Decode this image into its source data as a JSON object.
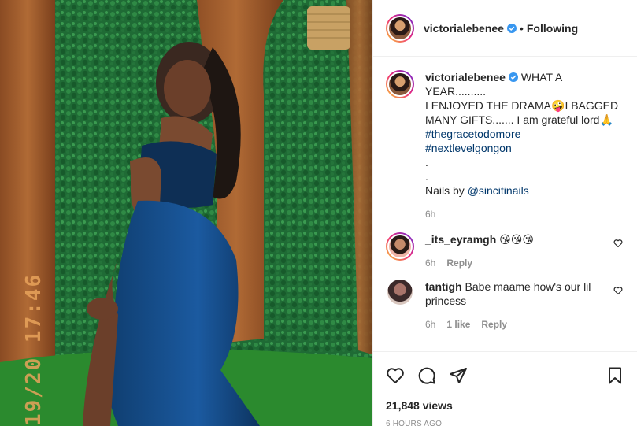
{
  "post": {
    "username": "victorialebenee",
    "follow_separator": "•",
    "follow_state": "Following",
    "more_label": "•••",
    "caption": {
      "username": "victorialebenee",
      "line1": "WHAT A YEAR..........",
      "line2a": "I ENJOYED THE DRAMA",
      "emoji1": "🤪",
      "line2b": "I BAGGED",
      "line3": "MANY GIFTS....... I am grateful lord",
      "emoji2": "🙏",
      "hashtag1": "#thegracetodomore",
      "hashtag2": "#nextlevelgongon",
      "dot1": ".",
      "dot2": ".",
      "nails_prefix": "Nails by ",
      "mention": "@sincitinails",
      "time": "6h"
    },
    "views": "21,848 views",
    "time_ago": "6 HOURS AGO"
  },
  "media": {
    "timestamp": "19/20 17:46"
  },
  "comments": [
    {
      "username": "_its_eyramgh",
      "text": "😘😘😘",
      "time": "6h",
      "likes": "",
      "reply": "Reply"
    },
    {
      "username": "tantigh",
      "text": "Babe maame how's our lil princess",
      "time": "6h",
      "likes": "1 like",
      "reply": "Reply"
    }
  ],
  "icons": {
    "like": "heart-outline-icon",
    "comment": "comment-bubble-icon",
    "share": "paper-plane-icon",
    "save": "bookmark-icon",
    "verified": "verified-badge-icon",
    "comment_like": "small-heart-icon"
  },
  "colors": {
    "link": "#00376b",
    "muted": "#8e8e8e",
    "verified": "#3897f0",
    "border": "#efefef"
  }
}
